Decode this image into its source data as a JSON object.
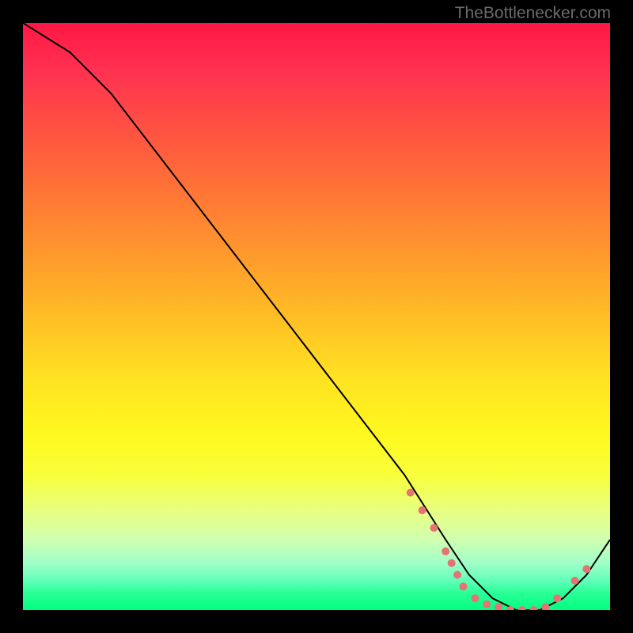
{
  "watermark": "TheBottlenecker.com",
  "chart_data": {
    "type": "line",
    "title": "",
    "xlabel": "",
    "ylabel": "",
    "xlim": [
      0,
      100
    ],
    "ylim": [
      0,
      100
    ],
    "series": [
      {
        "name": "bottleneck-curve",
        "x": [
          0,
          8,
          15,
          25,
          35,
          45,
          55,
          65,
          72,
          76,
          80,
          84,
          88,
          92,
          96,
          100
        ],
        "y": [
          100,
          95,
          88,
          75,
          62,
          49,
          36,
          23,
          12,
          6,
          2,
          0,
          0,
          2,
          6,
          12
        ]
      }
    ],
    "markers": [
      {
        "x": 66,
        "y": 20
      },
      {
        "x": 68,
        "y": 17
      },
      {
        "x": 70,
        "y": 14
      },
      {
        "x": 72,
        "y": 10
      },
      {
        "x": 73,
        "y": 8
      },
      {
        "x": 74,
        "y": 6
      },
      {
        "x": 75,
        "y": 4
      },
      {
        "x": 77,
        "y": 2
      },
      {
        "x": 79,
        "y": 1
      },
      {
        "x": 81,
        "y": 0.5
      },
      {
        "x": 83,
        "y": 0
      },
      {
        "x": 85,
        "y": 0
      },
      {
        "x": 87,
        "y": 0
      },
      {
        "x": 89,
        "y": 0.5
      },
      {
        "x": 91,
        "y": 2
      },
      {
        "x": 94,
        "y": 5
      },
      {
        "x": 96,
        "y": 7
      }
    ],
    "marker_color": "#e57373",
    "line_color": "#000000"
  }
}
